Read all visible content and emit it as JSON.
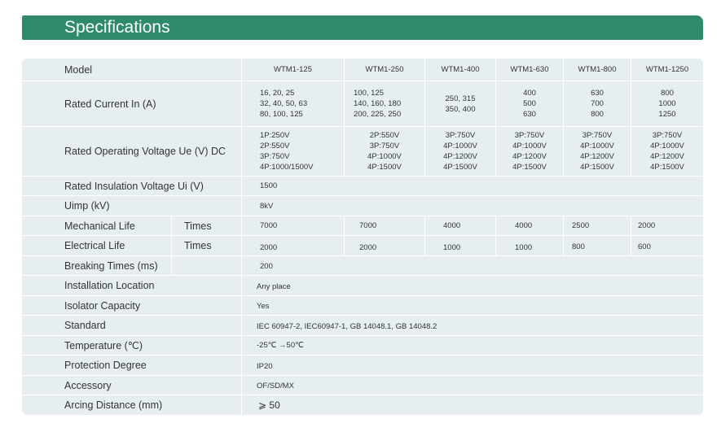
{
  "header": {
    "title": "Specifications"
  },
  "models": [
    "WTM1-125",
    "WTM1-250",
    "WTM1-400",
    "WTM1-630",
    "WTM1-800",
    "WTM1-1250"
  ],
  "rows": {
    "model": {
      "label": "Model"
    },
    "rated_current": {
      "label": "Rated Current In (A)",
      "values": [
        "16, 20, 25\n32, 40, 50, 63\n80, 100, 125",
        "100, 125\n140, 160, 180\n200, 225, 250",
        "250, 315\n350, 400",
        "400\n500\n630",
        "630\n700\n800",
        "800\n1000\n1250"
      ]
    },
    "rated_voltage": {
      "label": "Rated Operating Voltage Ue (V) DC",
      "values": [
        "1P:250V\n2P:550V\n3P:750V\n4P:1000/1500V",
        "2P:550V\n3P:750V\n4P:1000V\n4P:1500V",
        "3P:750V\n4P:1000V\n4P:1200V\n4P:1500V",
        "3P:750V\n4P:1000V\n4P:1200V\n4P:1500V",
        "3P:750V\n4P:1000V\n4P:1200V\n4P:1500V",
        "3P:750V\n4P:1000V\n4P:1200V\n4P:1500V"
      ]
    },
    "insulation_voltage": {
      "label": "Rated Insulation Voltage Ui (V)",
      "value": "1500"
    },
    "uimp": {
      "label": "Uimp (kV)",
      "value": "8kV"
    },
    "mechanical_life": {
      "label": "Mechanical Life",
      "unit": "Times",
      "values": [
        "7000",
        "7000",
        "4000",
        "4000",
        "2500",
        "2000"
      ]
    },
    "electrical_life": {
      "label": "Electrical Life",
      "unit": "Times",
      "values": [
        "2000",
        "2000",
        "1000",
        "1000",
        "800",
        "600"
      ]
    },
    "breaking_times": {
      "label": "Breaking Times (ms)",
      "value": "200"
    },
    "installation": {
      "label": "Installation Location",
      "value": "Any place"
    },
    "isolator": {
      "label": "Isolator Capacity",
      "value": "Yes"
    },
    "standard": {
      "label": "Standard",
      "value": "IEC 60947-2, IEC60947-1, GB 14048.1, GB 14048.2"
    },
    "temperature": {
      "label": "Temperature (℃)",
      "value": "-25℃ →50℃"
    },
    "protection": {
      "label": "Protection Degree",
      "value": "IP20"
    },
    "accessory": {
      "label": "Accessory",
      "value": "OF/SD/MX"
    },
    "arcing": {
      "label": "Arcing Distance (mm)",
      "value": "⩾ 50"
    }
  }
}
